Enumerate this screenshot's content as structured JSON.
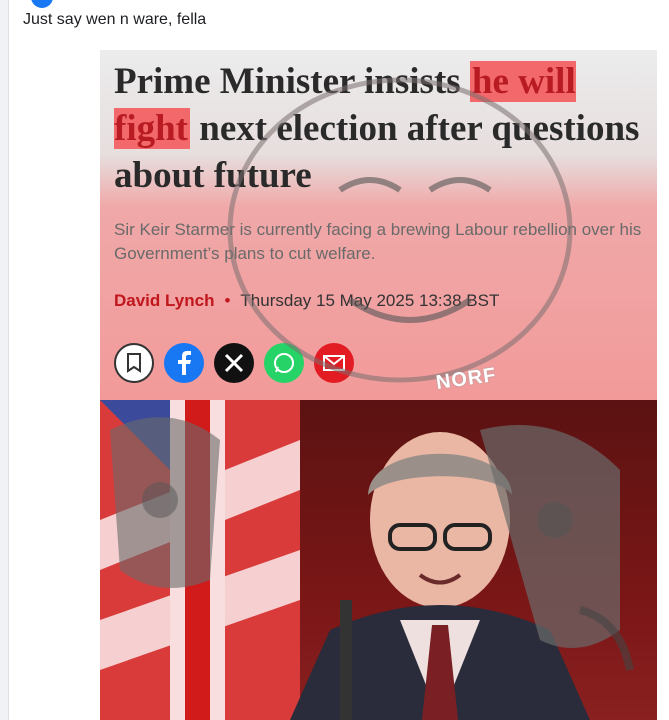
{
  "post": {
    "caption": "Just say wen n ware, fella"
  },
  "article": {
    "headline_part1": "Prime Minister insists ",
    "headline_highlight": "he will fight",
    "headline_part2": " next election after questions about future",
    "standfirst": "Sir Keir Starmer is currently facing a brewing Labour rebellion over his Government’s plans to cut welfare.",
    "author": "David Lynch",
    "separator": "•",
    "datetime": "Thursday 15 May 2025 13:38 BST",
    "share_icons": [
      "bookmark-icon",
      "facebook-icon",
      "x-icon",
      "whatsapp-icon",
      "email-icon"
    ],
    "brand_red": "#c0161c"
  },
  "meme": {
    "overlay_text": "NORF"
  }
}
